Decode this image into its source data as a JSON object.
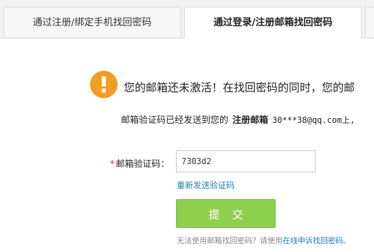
{
  "tabs": [
    {
      "label": "通过注册/绑定手机找回密码",
      "active": false
    },
    {
      "label": "通过登录/注册邮箱找回密码",
      "active": true
    }
  ],
  "notice": {
    "icon": "exclamation-icon",
    "icon_color": "#f39c22",
    "message": "您的邮箱还未激活！在找回密码的同时，您的邮"
  },
  "sent": {
    "prefix": "邮箱验证码已经发送到您的",
    "label": "注册邮箱",
    "email": "30***38@qq.com上,"
  },
  "form": {
    "required_mark": "*",
    "code_label": "邮箱验证码：",
    "code_value": "7303d2",
    "resend_link": "重新发送验证码",
    "submit_label": "提交",
    "submit_color": "#8dd04d"
  },
  "footer": {
    "text": "无法使用邮箱找回密码？请使用",
    "link": "在线申诉找回密码",
    "suffix": "。"
  }
}
